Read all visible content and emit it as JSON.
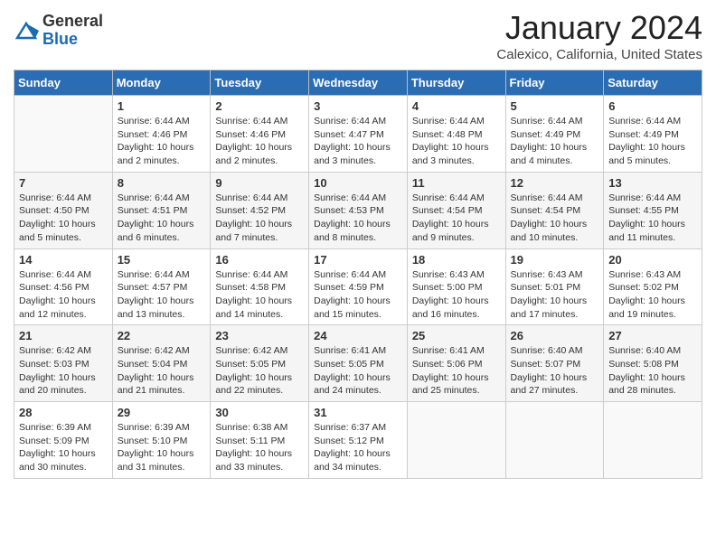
{
  "header": {
    "logo_general": "General",
    "logo_blue": "Blue",
    "title": "January 2024",
    "location": "Calexico, California, United States"
  },
  "days_of_week": [
    "Sunday",
    "Monday",
    "Tuesday",
    "Wednesday",
    "Thursday",
    "Friday",
    "Saturday"
  ],
  "weeks": [
    [
      {
        "day": "",
        "info": ""
      },
      {
        "day": "1",
        "info": "Sunrise: 6:44 AM\nSunset: 4:46 PM\nDaylight: 10 hours\nand 2 minutes."
      },
      {
        "day": "2",
        "info": "Sunrise: 6:44 AM\nSunset: 4:46 PM\nDaylight: 10 hours\nand 2 minutes."
      },
      {
        "day": "3",
        "info": "Sunrise: 6:44 AM\nSunset: 4:47 PM\nDaylight: 10 hours\nand 3 minutes."
      },
      {
        "day": "4",
        "info": "Sunrise: 6:44 AM\nSunset: 4:48 PM\nDaylight: 10 hours\nand 3 minutes."
      },
      {
        "day": "5",
        "info": "Sunrise: 6:44 AM\nSunset: 4:49 PM\nDaylight: 10 hours\nand 4 minutes."
      },
      {
        "day": "6",
        "info": "Sunrise: 6:44 AM\nSunset: 4:49 PM\nDaylight: 10 hours\nand 5 minutes."
      }
    ],
    [
      {
        "day": "7",
        "info": "Sunrise: 6:44 AM\nSunset: 4:50 PM\nDaylight: 10 hours\nand 5 minutes."
      },
      {
        "day": "8",
        "info": "Sunrise: 6:44 AM\nSunset: 4:51 PM\nDaylight: 10 hours\nand 6 minutes."
      },
      {
        "day": "9",
        "info": "Sunrise: 6:44 AM\nSunset: 4:52 PM\nDaylight: 10 hours\nand 7 minutes."
      },
      {
        "day": "10",
        "info": "Sunrise: 6:44 AM\nSunset: 4:53 PM\nDaylight: 10 hours\nand 8 minutes."
      },
      {
        "day": "11",
        "info": "Sunrise: 6:44 AM\nSunset: 4:54 PM\nDaylight: 10 hours\nand 9 minutes."
      },
      {
        "day": "12",
        "info": "Sunrise: 6:44 AM\nSunset: 4:54 PM\nDaylight: 10 hours\nand 10 minutes."
      },
      {
        "day": "13",
        "info": "Sunrise: 6:44 AM\nSunset: 4:55 PM\nDaylight: 10 hours\nand 11 minutes."
      }
    ],
    [
      {
        "day": "14",
        "info": "Sunrise: 6:44 AM\nSunset: 4:56 PM\nDaylight: 10 hours\nand 12 minutes."
      },
      {
        "day": "15",
        "info": "Sunrise: 6:44 AM\nSunset: 4:57 PM\nDaylight: 10 hours\nand 13 minutes."
      },
      {
        "day": "16",
        "info": "Sunrise: 6:44 AM\nSunset: 4:58 PM\nDaylight: 10 hours\nand 14 minutes."
      },
      {
        "day": "17",
        "info": "Sunrise: 6:44 AM\nSunset: 4:59 PM\nDaylight: 10 hours\nand 15 minutes."
      },
      {
        "day": "18",
        "info": "Sunrise: 6:43 AM\nSunset: 5:00 PM\nDaylight: 10 hours\nand 16 minutes."
      },
      {
        "day": "19",
        "info": "Sunrise: 6:43 AM\nSunset: 5:01 PM\nDaylight: 10 hours\nand 17 minutes."
      },
      {
        "day": "20",
        "info": "Sunrise: 6:43 AM\nSunset: 5:02 PM\nDaylight: 10 hours\nand 19 minutes."
      }
    ],
    [
      {
        "day": "21",
        "info": "Sunrise: 6:42 AM\nSunset: 5:03 PM\nDaylight: 10 hours\nand 20 minutes."
      },
      {
        "day": "22",
        "info": "Sunrise: 6:42 AM\nSunset: 5:04 PM\nDaylight: 10 hours\nand 21 minutes."
      },
      {
        "day": "23",
        "info": "Sunrise: 6:42 AM\nSunset: 5:05 PM\nDaylight: 10 hours\nand 22 minutes."
      },
      {
        "day": "24",
        "info": "Sunrise: 6:41 AM\nSunset: 5:05 PM\nDaylight: 10 hours\nand 24 minutes."
      },
      {
        "day": "25",
        "info": "Sunrise: 6:41 AM\nSunset: 5:06 PM\nDaylight: 10 hours\nand 25 minutes."
      },
      {
        "day": "26",
        "info": "Sunrise: 6:40 AM\nSunset: 5:07 PM\nDaylight: 10 hours\nand 27 minutes."
      },
      {
        "day": "27",
        "info": "Sunrise: 6:40 AM\nSunset: 5:08 PM\nDaylight: 10 hours\nand 28 minutes."
      }
    ],
    [
      {
        "day": "28",
        "info": "Sunrise: 6:39 AM\nSunset: 5:09 PM\nDaylight: 10 hours\nand 30 minutes."
      },
      {
        "day": "29",
        "info": "Sunrise: 6:39 AM\nSunset: 5:10 PM\nDaylight: 10 hours\nand 31 minutes."
      },
      {
        "day": "30",
        "info": "Sunrise: 6:38 AM\nSunset: 5:11 PM\nDaylight: 10 hours\nand 33 minutes."
      },
      {
        "day": "31",
        "info": "Sunrise: 6:37 AM\nSunset: 5:12 PM\nDaylight: 10 hours\nand 34 minutes."
      },
      {
        "day": "",
        "info": ""
      },
      {
        "day": "",
        "info": ""
      },
      {
        "day": "",
        "info": ""
      }
    ]
  ]
}
